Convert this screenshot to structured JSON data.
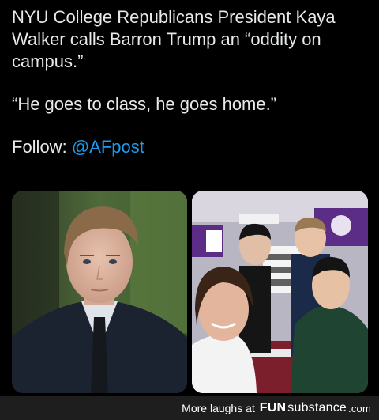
{
  "post": {
    "line1": "NYU College Republicans President Kaya Walker calls Barron Trump an “oddity on campus.”",
    "line2": "“He goes to class, he goes home.”",
    "follow_label": "Follow:",
    "follow_handle": "@AFpost"
  },
  "media": {
    "left_photo_alt": "Portrait of young man in dark suit",
    "right_photo_alt": "Selfie of four students at club fair"
  },
  "footer": {
    "tagline": "More laughs at",
    "brand_fun": "FUN",
    "brand_sub": "substance",
    "brand_dom": ".com"
  }
}
